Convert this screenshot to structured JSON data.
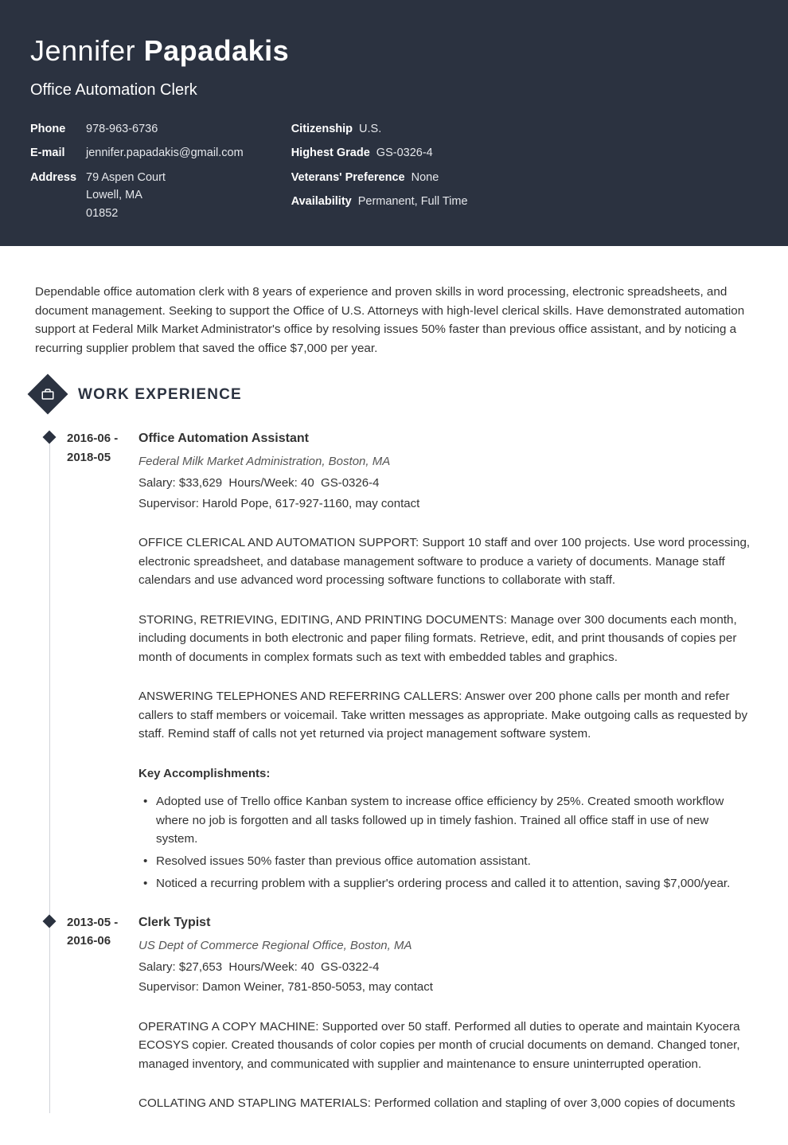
{
  "header": {
    "first_name": "Jennifer",
    "last_name": "Papadakis",
    "title": "Office Automation Clerk",
    "left": {
      "phone_label": "Phone",
      "phone": "978-963-6736",
      "email_label": "E-mail",
      "email": "jennifer.papadakis@gmail.com",
      "address_label": "Address",
      "address_line1": "79 Aspen Court",
      "address_line2": "Lowell, MA",
      "address_line3": "01852"
    },
    "right": {
      "citizenship_label": "Citizenship",
      "citizenship": "U.S.",
      "grade_label": "Highest Grade",
      "grade": "GS-0326-4",
      "veterans_label": "Veterans' Preference",
      "veterans": "None",
      "availability_label": "Availability",
      "availability": "Permanent, Full Time"
    }
  },
  "summary": "Dependable office automation clerk with 8 years of experience and proven skills in word processing, electronic spreadsheets, and document management. Seeking to support the Office of U.S. Attorneys with high-level clerical skills. Have demonstrated automation support at Federal Milk Market Administrator's office by resolving issues 50% faster than previous office assistant, and by noticing a recurring supplier problem that saved the office $7,000 per year.",
  "section_work": "WORK EXPERIENCE",
  "jobs": [
    {
      "dates": "2016-06 - 2018-05",
      "title": "Office Automation Assistant",
      "org": "Federal Milk Market Administration, Boston, MA",
      "salary": "Salary: $33,629",
      "hours": "Hours/Week: 40",
      "grade": "GS-0326-4",
      "supervisor": "Supervisor: Harold Pope, 617-927-1160, may contact",
      "p1": "OFFICE CLERICAL AND AUTOMATION SUPPORT: Support 10 staff and over 100 projects. Use word processing, electronic spreadsheet, and database management software to produce a variety of documents. Manage staff calendars and use advanced word processing software functions to collaborate with staff.",
      "p2": "STORING, RETRIEVING, EDITING, AND PRINTING DOCUMENTS: Manage over 300 documents each month, including documents in both electronic and paper filing formats. Retrieve, edit, and print thousands of copies per month of documents in complex formats such as text with embedded tables and graphics.",
      "p3": "ANSWERING TELEPHONES AND REFERRING CALLERS: Answer over 200 phone calls per month and refer callers to staff members or voicemail. Take written messages as appropriate. Make outgoing calls as requested by staff. Remind staff of calls not yet returned via project management software system.",
      "key_label": "Key Accomplishments:",
      "bullets": [
        "Adopted use of Trello office Kanban system to increase office efficiency by 25%. Created smooth workflow where no job is forgotten and all tasks followed up in timely fashion. Trained all office staff in use of new system.",
        "Resolved issues 50% faster than previous office automation assistant.",
        "Noticed a recurring problem with a supplier's ordering process and called it to attention, saving $7,000/year."
      ]
    },
    {
      "dates": "2013-05 - 2016-06",
      "title": "Clerk Typist",
      "org": "US Dept of Commerce Regional Office, Boston, MA",
      "salary": "Salary: $27,653",
      "hours": "Hours/Week: 40",
      "grade": "GS-0322-4",
      "supervisor": "Supervisor: Damon Weiner, 781-850-5053, may contact",
      "p1": "OPERATING A COPY MACHINE: Supported over 50 staff. Performed all duties to operate and maintain Kyocera ECOSYS copier. Created thousands of color copies per month of crucial documents on demand. Changed toner, managed inventory, and communicated with supplier and maintenance to ensure uninterrupted operation.",
      "p2": "COLLATING AND STAPLING MATERIALS: Performed collation and stapling of over 3,000 copies of documents"
    }
  ]
}
